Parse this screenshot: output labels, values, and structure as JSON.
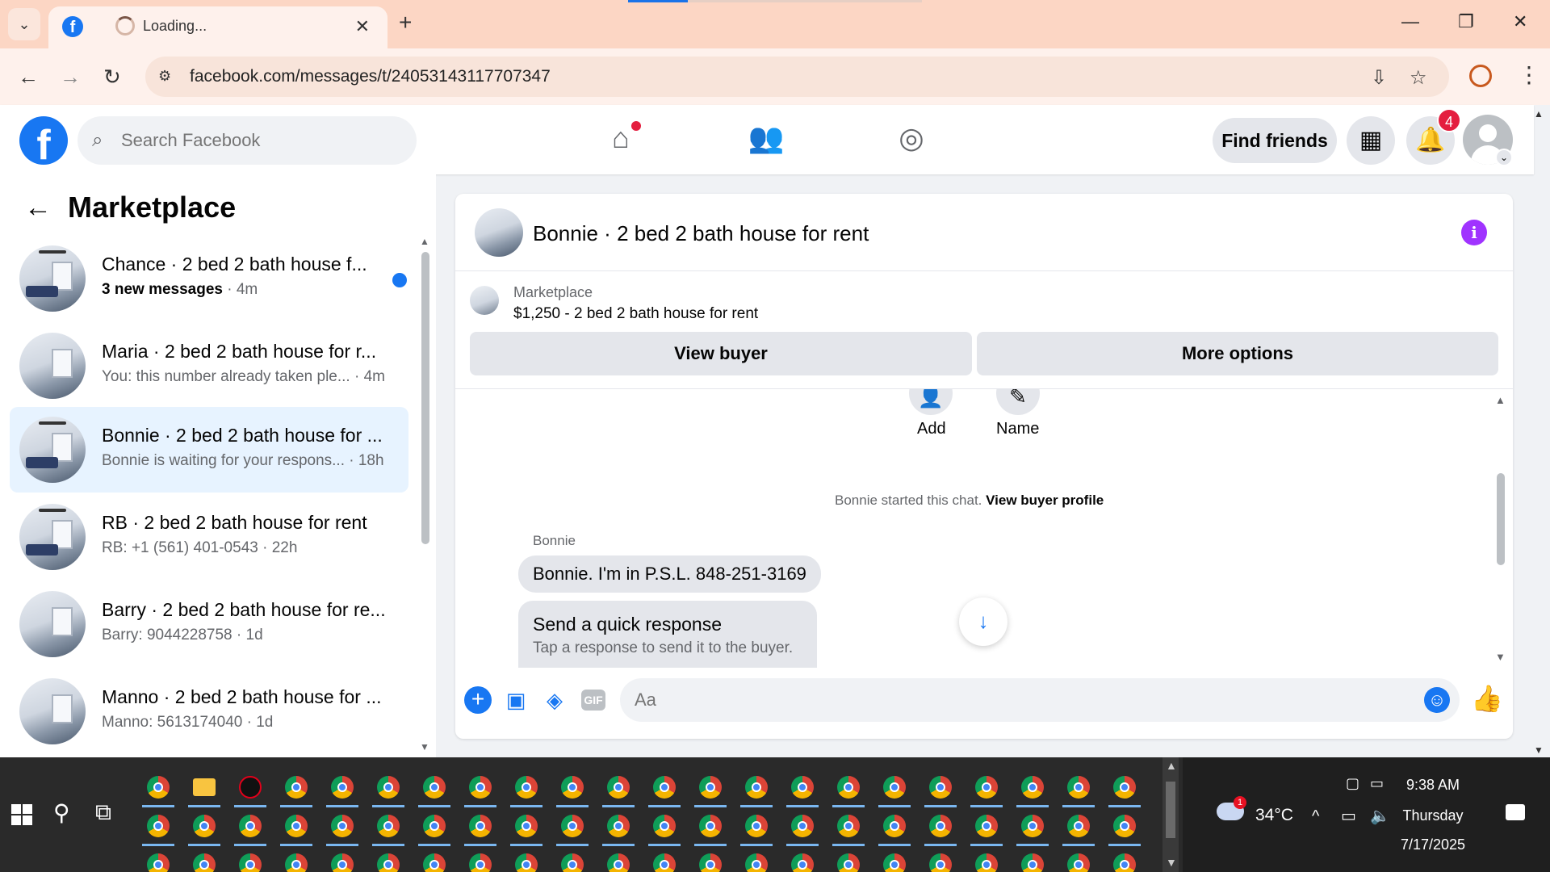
{
  "browser": {
    "tab_title": "Loading...",
    "url": "facebook.com/messages/t/24053143117707347"
  },
  "header": {
    "search_placeholder": "Search Facebook",
    "find_friends_label": "Find friends",
    "notification_count": "4"
  },
  "sidebar": {
    "title": "Marketplace",
    "conversations": [
      {
        "name": "Chance · 2 bed 2 bath house f...",
        "preview": "3 new messages",
        "time": " · 4m",
        "unread": true
      },
      {
        "name": "Maria · 2 bed 2 bath house for r...",
        "preview": "You: this number already taken ple... · 4m",
        "unread": false
      },
      {
        "name": "Bonnie · 2 bed 2 bath house for ...",
        "preview": "Bonnie is waiting for your respons... · 18h",
        "unread": false,
        "active": true
      },
      {
        "name": "RB · 2 bed 2 bath house for rent",
        "preview": "RB: +1 (561) 401-0543 · 22h",
        "unread": false
      },
      {
        "name": "Barry · 2 bed 2 bath house for re...",
        "preview": "Barry: 9044228758 · 1d",
        "unread": false
      },
      {
        "name": "Manno · 2 bed 2 bath house for ...",
        "preview": "Manno: 5613174040 · 1d",
        "unread": false
      }
    ]
  },
  "chat": {
    "title": "Bonnie · 2 bed 2 bath house for rent",
    "listing_category": "Marketplace",
    "listing_price": "$1,250 - 2 bed 2 bath house for rent",
    "view_buyer_label": "View buyer",
    "more_options_label": "More options",
    "add_label": "Add",
    "name_label": "Name",
    "started_text": "Bonnie started this chat.",
    "view_profile_label": "View buyer profile",
    "sender": "Bonnie",
    "message": "Bonnie.  I'm in P.S.L. 848-251-3169",
    "quick_title": "Send a quick response",
    "quick_subtitle": "Tap a response to send it to the buyer.",
    "composer_placeholder": "Aa"
  },
  "taskbar": {
    "weather_badge": "1",
    "temperature": "34°C",
    "time": "9:38 AM",
    "day": "Thursday",
    "date": "7/17/2025"
  },
  "colors": {
    "facebook_blue": "#1877f2",
    "active_conversation": "#e7f3ff",
    "notification_red": "#e41e3f",
    "info_purple": "#a033ff"
  }
}
